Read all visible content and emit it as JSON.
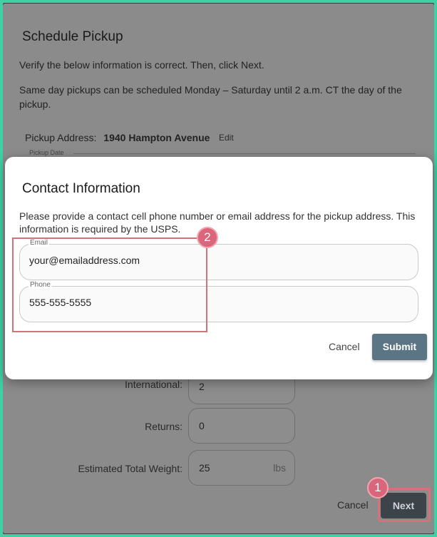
{
  "background": {
    "title": "Schedule Pickup",
    "intro": "Verify the below information is correct. Then, click Next.",
    "note": "Same day pickups can be scheduled Monday – Saturday until 2 a.m. CT the day of the pickup.",
    "pickup_address_label": "Pickup Address:",
    "pickup_address_value": "1940 Hampton Avenue",
    "edit_label": "Edit",
    "pickup_date_label": "Pickup Date",
    "fields": [
      {
        "label": "International:",
        "value": "2",
        "unit": ""
      },
      {
        "label": "Returns:",
        "value": "0",
        "unit": ""
      },
      {
        "label": "Estimated Total Weight:",
        "value": "25",
        "unit": "lbs"
      }
    ],
    "cancel_label": "Cancel",
    "next_label": "Next"
  },
  "modal": {
    "title": "Contact Information",
    "description": "Please provide a contact cell phone number or email address for the pickup address. This information is required by the USPS.",
    "email_label": "Email",
    "email_value": "your@emailaddress.com",
    "phone_label": "Phone",
    "phone_value": "555-555-5555",
    "cancel_label": "Cancel",
    "submit_label": "Submit"
  },
  "annotations": {
    "marker_1": "1",
    "marker_2": "2",
    "highlight_color": "#d6717a"
  },
  "colors": {
    "accent": "#5b7585",
    "frame": "#3fd0a4"
  }
}
